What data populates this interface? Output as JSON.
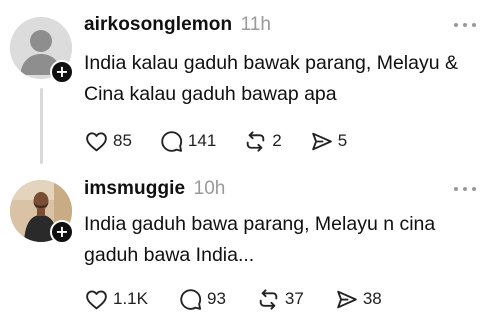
{
  "posts": [
    {
      "username": "airkosonglemon",
      "timestamp": "11h",
      "text": "India kalau gaduh bawak parang, Melayu & Cina kalau gaduh bawap apa",
      "counts": {
        "likes": "85",
        "replies": "141",
        "reposts": "2",
        "shares": "5"
      }
    },
    {
      "username": "imsmuggie",
      "timestamp": "10h",
      "text": "India gaduh bawa parang, Melayu n cina gaduh bawa India...",
      "counts": {
        "likes": "1.1K",
        "replies": "93",
        "reposts": "37",
        "shares": "38"
      }
    }
  ],
  "icons": {
    "follow": "plus-icon",
    "more": "more-horizontal-icon",
    "like": "heart-icon",
    "reply": "comment-icon",
    "repost": "repost-icon",
    "share": "send-icon"
  },
  "colors": {
    "text": "#101010",
    "muted": "#999999",
    "thread_line": "#d9d9d9",
    "default_avatar": "#dcdcdc"
  }
}
